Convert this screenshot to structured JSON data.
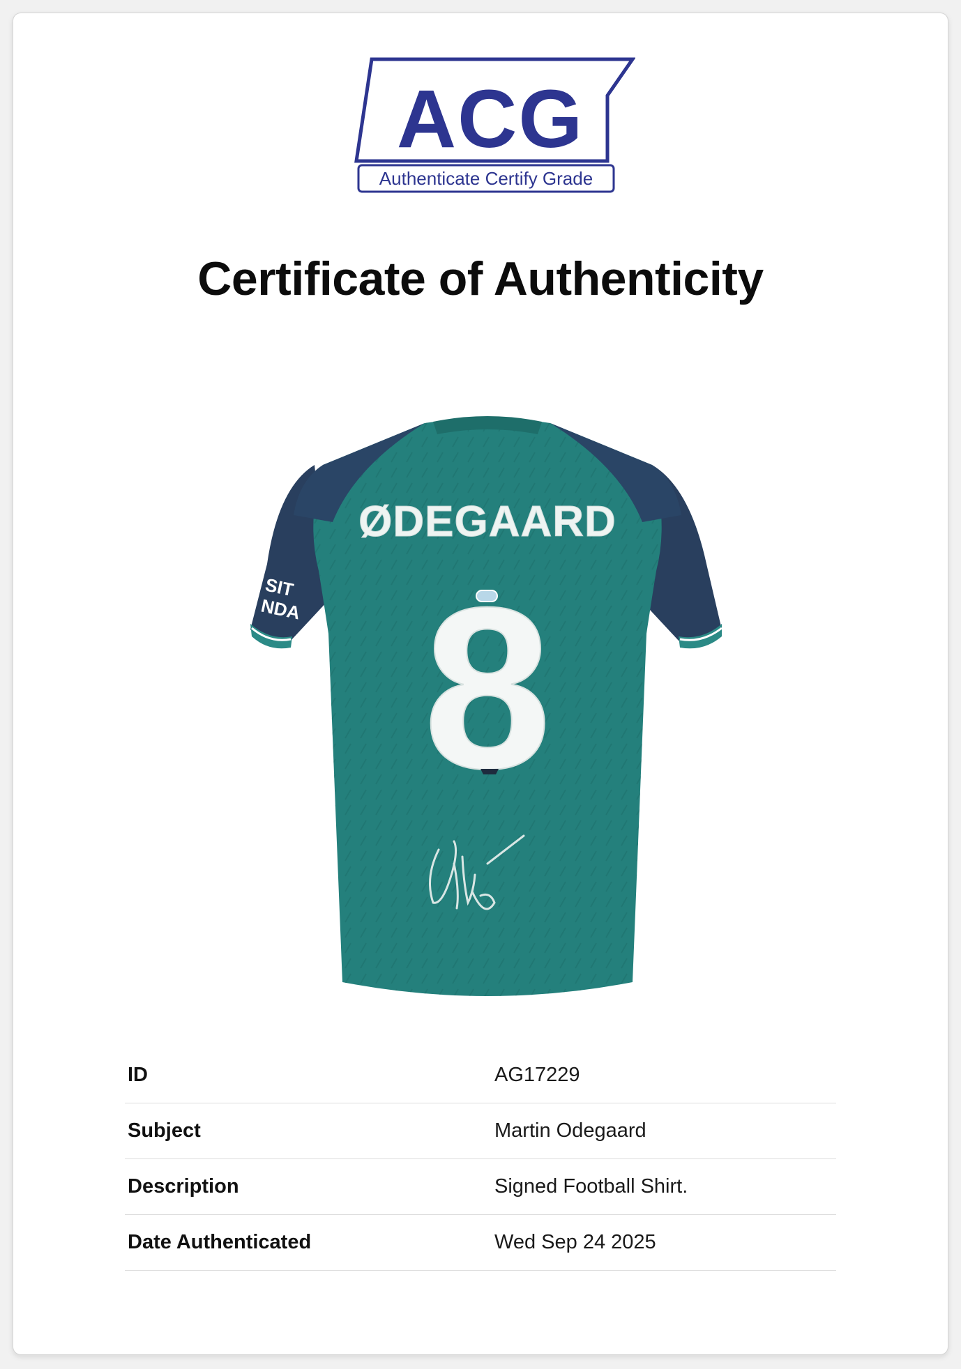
{
  "logo": {
    "letters": "ACG",
    "tagline": "Authenticate Certify Grade",
    "color": "#2d3590"
  },
  "title": "Certificate of Authenticity",
  "shirt": {
    "name_print": "ØDEGAARD",
    "number_print": "8",
    "sleeve_print_1": "SIT",
    "sleeve_print_2": "NDA",
    "body_color": "#24807c",
    "sleeve_color": "#293f5e"
  },
  "details": [
    {
      "label": "ID",
      "value": "AG17229"
    },
    {
      "label": "Subject",
      "value": "Martin Odegaard"
    },
    {
      "label": "Description",
      "value": "Signed Football Shirt."
    },
    {
      "label": "Date Authenticated",
      "value": "Wed Sep 24 2025"
    }
  ]
}
